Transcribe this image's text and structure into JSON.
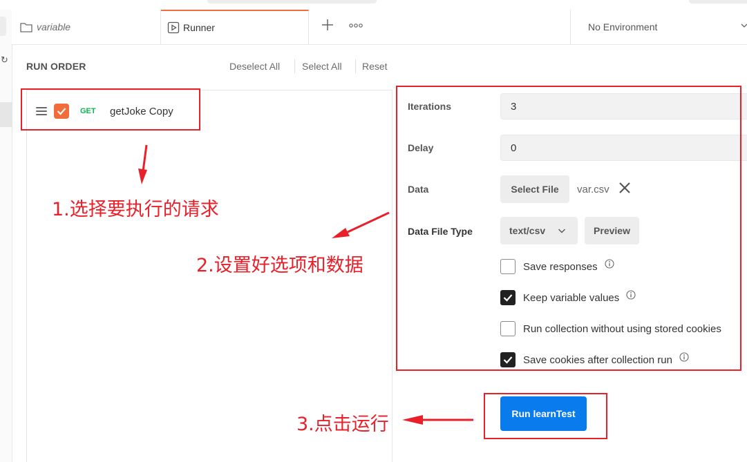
{
  "tabs": [
    {
      "label": "variable",
      "icon": "folder-icon"
    },
    {
      "label": "Runner",
      "icon": "runner-icon"
    }
  ],
  "tabbar": {
    "add_icon": "plus-icon",
    "more_icon": "more-icon"
  },
  "environment": {
    "selected": "No Environment"
  },
  "run_order": {
    "title": "RUN ORDER",
    "deselect_all": "Deselect All",
    "select_all": "Select All",
    "reset": "Reset",
    "requests": [
      {
        "method": "GET",
        "name": "getJoke Copy",
        "checked": true
      }
    ]
  },
  "settings": {
    "iterations_label": "Iterations",
    "iterations_value": "3",
    "delay_label": "Delay",
    "delay_value": "0",
    "data_label": "Data",
    "select_file_label": "Select File",
    "file_name": "var.csv",
    "data_file_type_label": "Data File Type",
    "data_file_type_value": "text/csv",
    "preview_label": "Preview",
    "options": [
      {
        "label": "Save responses",
        "checked": false,
        "info": true
      },
      {
        "label": "Keep variable values",
        "checked": true,
        "info": true
      },
      {
        "label": "Run collection without using stored cookies",
        "checked": false,
        "info": false
      },
      {
        "label": "Save cookies after collection run",
        "checked": true,
        "info": true
      }
    ]
  },
  "run_button": {
    "label": "Run learnTest"
  },
  "annotations": {
    "step1": "1.选择要执行的请求",
    "step2": "2.设置好选项和数据",
    "step3": "3.点击运行"
  },
  "colors": {
    "accent_orange": "#f26b3a",
    "run_blue": "#097bed",
    "annotation_red": "#e8202a",
    "get_green": "#0cb552"
  }
}
